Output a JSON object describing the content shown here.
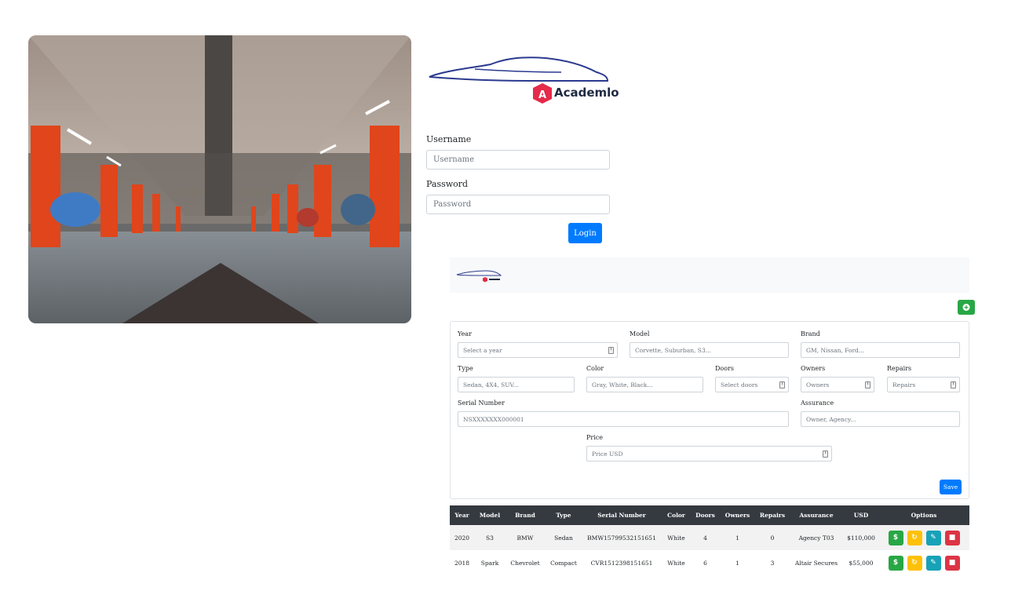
{
  "brand": {
    "name": "Academlo",
    "logo_icon": "academlo-logo-icon"
  },
  "login": {
    "username_label": "Username",
    "username_placeholder": "Username",
    "password_label": "Password",
    "password_placeholder": "Password",
    "login_button": "Login"
  },
  "form": {
    "year_label": "Year",
    "year_placeholder": "Select a year",
    "model_label": "Model",
    "model_placeholder": "Corvette, Suburban, S3...",
    "brand_label": "Brand",
    "brand_placeholder": "GM, Nissan, Ford...",
    "type_label": "Type",
    "type_placeholder": "Sedan, 4X4, SUV...",
    "color_label": "Color",
    "color_placeholder": "Gray, White, Black...",
    "doors_label": "Doors",
    "doors_placeholder": "Select doors",
    "owners_label": "Owners",
    "owners_placeholder": "Owners",
    "repairs_label": "Repairs",
    "repairs_placeholder": "Repairs",
    "serial_label": "Serial Number",
    "serial_placeholder": "NSXXXXXXX000001",
    "assurance_label": "Assurance",
    "assurance_placeholder": "Owner, Agency...",
    "price_label": "Price",
    "price_placeholder": "Price USD",
    "save_button": "Save",
    "add_icon": "plus-circle-icon"
  },
  "table": {
    "headers": [
      "Year",
      "Model",
      "Brand",
      "Type",
      "Serial Number",
      "Color",
      "Doors",
      "Owners",
      "Repairs",
      "Assurance",
      "USD",
      "Options"
    ],
    "rows": [
      [
        "2020",
        "S3",
        "BMW",
        "Sedan",
        "BMW15799532151651",
        "White",
        "4",
        "1",
        "0",
        "Agency T03",
        "$110,000"
      ],
      [
        "2018",
        "Spark",
        "Chevrolet",
        "Compact",
        "CVR1512398151651",
        "White",
        "6",
        "1",
        "3",
        "Altair Secures",
        "$55,000"
      ]
    ],
    "option_icons": [
      "dollar-icon",
      "sync-icon",
      "pencil-icon",
      "trash-icon"
    ],
    "option_glyphs": {
      "dollar": "$"
    }
  },
  "colors": {
    "primary": "#007bff",
    "success": "#28a745",
    "warning": "#ffc107",
    "info": "#17a2b8",
    "danger": "#dc3545",
    "dark": "#343a40",
    "pillar": "#e0451b"
  }
}
